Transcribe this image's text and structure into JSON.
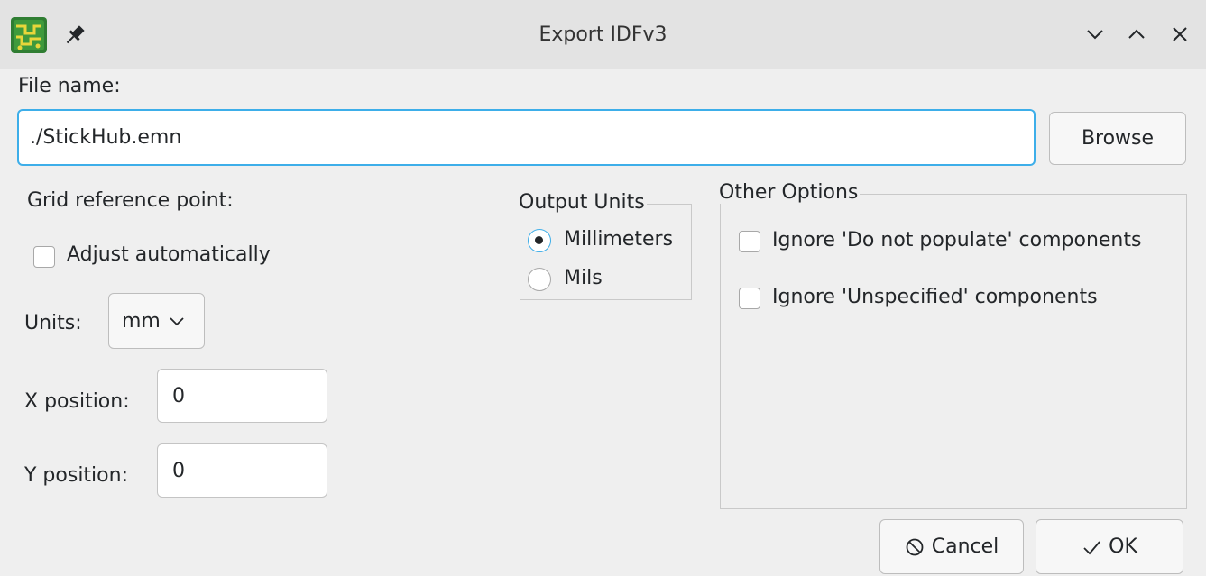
{
  "window": {
    "title": "Export IDFv3",
    "app_icon": "kicad-pcb-icon",
    "pin_icon": "pin-icon",
    "controls": [
      "minimize-icon",
      "maximize-icon",
      "close-icon"
    ]
  },
  "file": {
    "label": "File name:",
    "value": "./StickHub.emn",
    "browse_label": "Browse"
  },
  "grid": {
    "label": "Grid reference point:",
    "adjust_label": "Adjust automatically",
    "adjust_checked": false,
    "units_label": "Units:",
    "units_value": "mm",
    "x_label": "X position:",
    "x_value": "0",
    "y_label": "Y position:",
    "y_value": "0"
  },
  "output_units": {
    "title": "Output Units",
    "options": [
      "Millimeters",
      "Mils"
    ],
    "selected": "Millimeters"
  },
  "other_options": {
    "title": "Other Options",
    "items": [
      {
        "label": "Ignore 'Do not populate' components",
        "checked": false
      },
      {
        "label": "Ignore 'Unspecified' components",
        "checked": false
      }
    ]
  },
  "footer": {
    "cancel_label": "Cancel",
    "ok_label": "OK"
  },
  "colors": {
    "accent": "#3daee9",
    "background": "#efefef",
    "titlebar": "#e3e3e3"
  }
}
